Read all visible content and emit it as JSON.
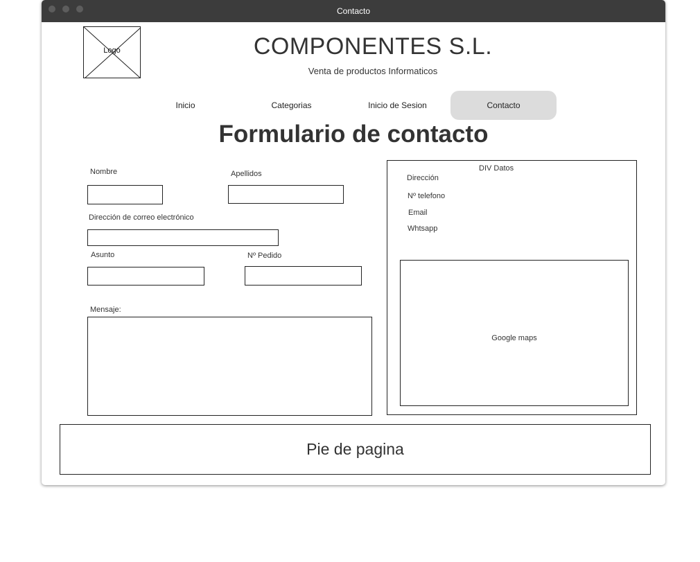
{
  "window": {
    "title": "Contacto"
  },
  "header": {
    "logo_label": "Logo",
    "company_name": "COMPONENTES S.L.",
    "tagline": "Venta de productos Informaticos"
  },
  "nav": {
    "items": [
      {
        "label": "Inicio"
      },
      {
        "label": "Categorias"
      },
      {
        "label": "Inicio de Sesion"
      },
      {
        "label": "Contacto"
      }
    ],
    "active": "Contacto"
  },
  "form": {
    "title": "Formulario de contacto",
    "fields": {
      "nombre": {
        "label": "Nombre",
        "value": ""
      },
      "apellidos": {
        "label": "Apellidos",
        "value": ""
      },
      "email": {
        "label": "Dirección de correo electrónico",
        "value": ""
      },
      "asunto": {
        "label": "Asunto",
        "value": ""
      },
      "pedido": {
        "label": "Nº Pedido",
        "value": ""
      },
      "mensaje": {
        "label": "Mensaje:",
        "value": ""
      }
    }
  },
  "datos": {
    "heading": "DIV Datos",
    "items": [
      "Dirección",
      "Nº telefono",
      "Email",
      "Whtsapp"
    ],
    "map_label": "Google maps"
  },
  "footer": {
    "text": "Pie de pagina"
  },
  "colors": {
    "titlebar": "#3c3c3c",
    "active_tab": "#dcdcdc",
    "text": "#333333",
    "border": "#222222"
  }
}
